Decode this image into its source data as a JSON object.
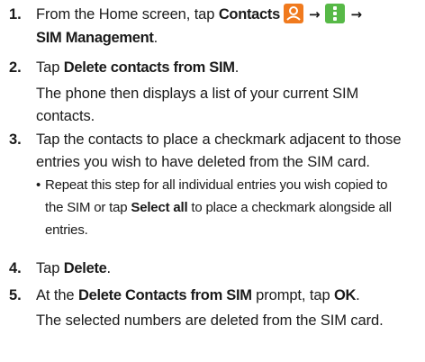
{
  "steps": [
    {
      "num": "1.",
      "line1_prefix": "From the Home screen, tap ",
      "line1_bold": "Contacts",
      "arrow": "→",
      "line2_bold": "SIM Management",
      "line2_suffix": "."
    },
    {
      "num": "2.",
      "prefix": "Tap ",
      "bold": "Delete contacts from SIM",
      "suffix": ".",
      "line2": "The phone then displays a list of your current SIM",
      "line3": "contacts."
    },
    {
      "num": "3.",
      "line1": "Tap the contacts to place a checkmark adjacent to those",
      "line2": "entries you wish to have deleted from the SIM card.",
      "bullet": {
        "mark": "•",
        "line1": "Repeat this step for all individual entries you wish copied to",
        "line2_prefix": "the SIM or tap ",
        "line2_bold": "Select all",
        "line2_suffix": " to place a checkmark alongside all",
        "line3": "entries."
      }
    },
    {
      "num": "4.",
      "prefix": "Tap ",
      "bold": "Delete",
      "suffix": "."
    },
    {
      "num": "5.",
      "prefix": "At the ",
      "bold": "Delete Contacts from SIM",
      "mid": " prompt, tap ",
      "bold2": "OK",
      "suffix": ".",
      "line2": "The selected numbers are deleted from the SIM card."
    }
  ],
  "icons": {
    "contacts": {
      "name": "contacts-app-icon",
      "color": "#f07a1e"
    },
    "menu": {
      "name": "menu-icon",
      "color": "#57b947"
    }
  }
}
